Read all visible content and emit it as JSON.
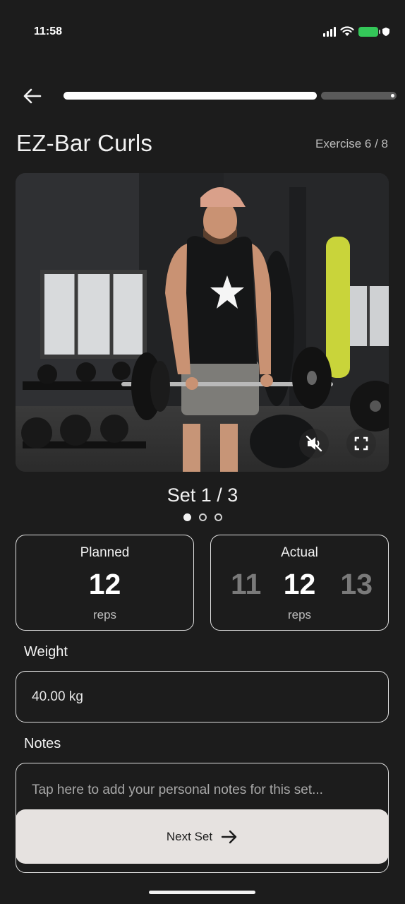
{
  "status_bar": {
    "time": "11:58"
  },
  "header": {
    "progress_fraction": 0.76,
    "title": "EZ-Bar Curls",
    "exercise_counter": "Exercise 6 / 8"
  },
  "video": {
    "mute_icon": "volume-muted-icon",
    "fullscreen_icon": "fullscreen-icon"
  },
  "set": {
    "title": "Set 1 / 3",
    "total_sets": 3,
    "current_set": 1
  },
  "planned": {
    "label": "Planned",
    "value": "12",
    "unit": "reps"
  },
  "actual": {
    "label": "Actual",
    "value": "12",
    "prev": "11",
    "next": "13",
    "unit": "reps"
  },
  "weight": {
    "label": "Weight",
    "value": "40.00 kg"
  },
  "notes": {
    "label": "Notes",
    "placeholder": "Tap here to add your personal notes for this set..."
  },
  "next_button": {
    "label": "Next Set"
  },
  "colors": {
    "background": "#1c1c1c",
    "battery": "#34c759",
    "button_bg": "#e6e2e0",
    "border": "#e0e0e0"
  }
}
